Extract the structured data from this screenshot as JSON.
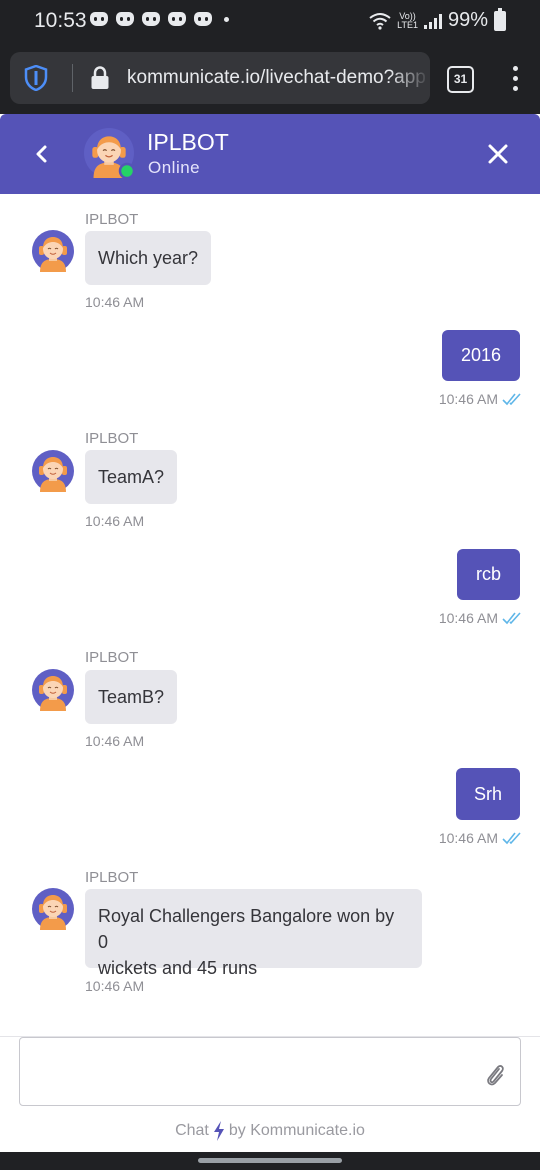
{
  "status_bar": {
    "time": "10:53",
    "network_label_top": "Vo))",
    "network_label_bottom": "LTE1",
    "battery": "99%"
  },
  "browser": {
    "url": "kommunicate.io/livechat-demo?app",
    "tab_count": "31"
  },
  "chat_header": {
    "title": "IPLBOT",
    "status": "Online",
    "accent_color": "#5553b7",
    "online_color": "#25d366"
  },
  "messages": [
    {
      "from": "bot",
      "sender": "IPLBOT",
      "text": "Which year?",
      "time": "10:46 AM"
    },
    {
      "from": "user",
      "text": "2016",
      "time": "10:46 AM",
      "read": true
    },
    {
      "from": "bot",
      "sender": "IPLBOT",
      "text": "TeamA?",
      "time": "10:46 AM"
    },
    {
      "from": "user",
      "text": "rcb",
      "time": "10:46 AM",
      "read": true
    },
    {
      "from": "bot",
      "sender": "IPLBOT",
      "text": "TeamB?",
      "time": "10:46 AM"
    },
    {
      "from": "user",
      "text": "Srh",
      "time": "10:46 AM",
      "read": true
    },
    {
      "from": "bot",
      "sender": "IPLBOT",
      "text_line1": "Royal Challengers Bangalore won by 0",
      "text_line2": "wickets and 45 runs",
      "time": "10:46 AM"
    }
  ],
  "composer": {
    "value": "",
    "placeholder": ""
  },
  "footer": {
    "powered_prefix": "Chat",
    "powered_suffix": "by Kommunicate.io"
  },
  "icons": [
    "discord-icon",
    "wifi-icon",
    "signal-icon",
    "battery-icon",
    "shield-icon",
    "lock-icon",
    "tabs-icon",
    "menu-icon",
    "back-icon",
    "avatar-icon",
    "close-icon",
    "double-check-icon",
    "paperclip-icon",
    "bolt-icon"
  ]
}
